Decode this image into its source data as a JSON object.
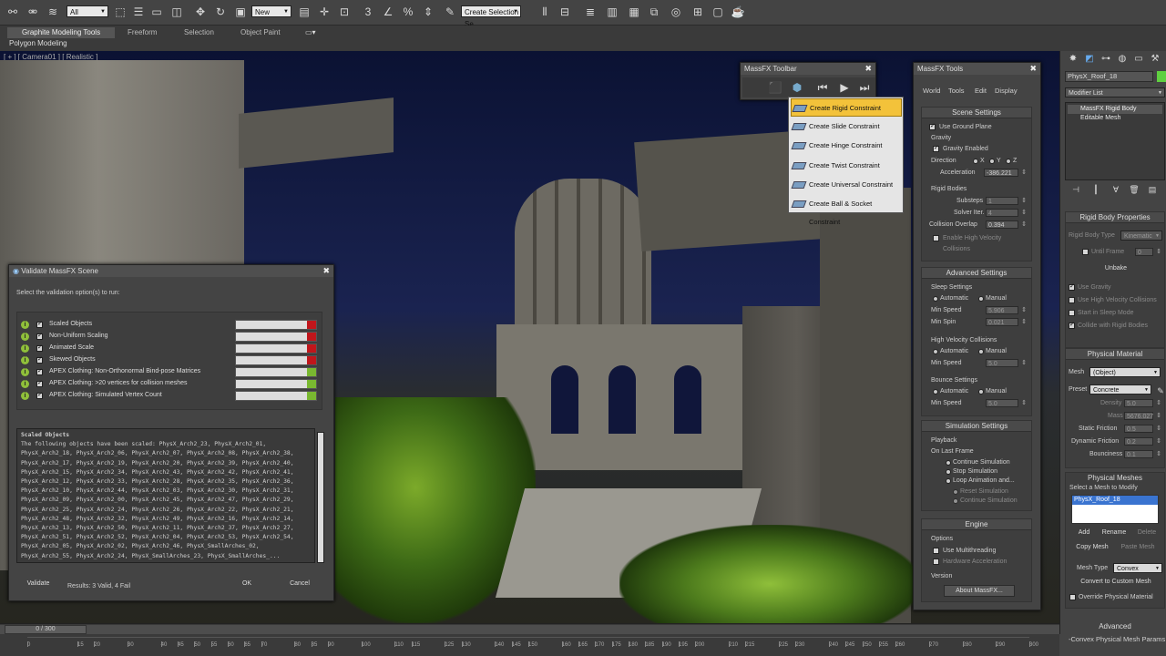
{
  "toolbar": {
    "filter": "All",
    "selection_set": "New",
    "named_selection": "Create Selection Se"
  },
  "ribbon": {
    "tabs": [
      "Graphite Modeling Tools",
      "Freeform",
      "Selection",
      "Object Paint"
    ],
    "sub_label": "Polygon Modeling"
  },
  "viewport": {
    "label": "[ + ] [ Camera01 ] [ Realistic ]"
  },
  "validate": {
    "title": "Validate MassFX Scene",
    "instruction": "Select the validation option(s) to run:",
    "rows": [
      {
        "label": "Scaled Objects",
        "status": "fail"
      },
      {
        "label": "Non-Uniform Scaling",
        "status": "fail"
      },
      {
        "label": "Animated Scale",
        "status": "fail"
      },
      {
        "label": "Skewed Objects",
        "status": "fail"
      },
      {
        "label": "APEX Clothing: Non-Orthonormal Bind-pose Matrices",
        "status": "pass"
      },
      {
        "label": "APEX Clothing: >20 vertices for collision meshes",
        "status": "pass"
      },
      {
        "label": "APEX Clothing: Simulated Vertex Count",
        "status": "pass"
      }
    ],
    "details_lines": [
      "Scaled Objects",
      "The following objects have been scaled: PhysX_Arch2_23, PhysX_Arch2_01,",
      "PhysX_Arch2_18, PhysX_Arch2_06, PhysX_Arch2_07, PhysX_Arch2_08, PhysX_Arch2_38,",
      "PhysX_Arch2_17, PhysX_Arch2_19, PhysX_Arch2_20, PhysX_Arch2_39, PhysX_Arch2_40,",
      "PhysX_Arch2_15, PhysX_Arch2_34, PhysX_Arch2_43, PhysX_Arch2_42, PhysX_Arch2_41,",
      "PhysX_Arch2_12, PhysX_Arch2_33, PhysX_Arch2_28, PhysX_Arch2_35, PhysX_Arch2_36,",
      "PhysX_Arch2_10, PhysX_Arch2_44, PhysX_Arch2_03, PhysX_Arch2_30, PhysX_Arch2_31,",
      "PhysX_Arch2_09, PhysX_Arch2_00, PhysX_Arch2_45, PhysX_Arch2_47, PhysX_Arch2_29,",
      "PhysX_Arch2_25, PhysX_Arch2_24, PhysX_Arch2_26, PhysX_Arch2_22, PhysX_Arch2_21,",
      "PhysX_Arch2_48, PhysX_Arch2_32, PhysX_Arch2_49, PhysX_Arch2_16, PhysX_Arch2_14,",
      "PhysX_Arch2_13, PhysX_Arch2_50, PhysX_Arch2_11, PhysX_Arch2_37, PhysX_Arch2_27,",
      "PhysX_Arch2_51, PhysX_Arch2_52, PhysX_Arch2_04, PhysX_Arch2_53, PhysX_Arch2_54,",
      "PhysX_Arch2_05, PhysX_Arch2_02, PhysX_Arch2_46, PhysX_SmallArches_02,",
      "PhysX_Arch2_55, PhysX_Arch2_24, PhysX_SmallArches_23, PhysX_SmallArches_..."
    ],
    "validate_button": "Validate",
    "results": "Results: 3 Valid, 4 Fail",
    "ok_button": "OK",
    "cancel_button": "Cancel"
  },
  "massfx_toolbar": {
    "title": "MassFX Toolbar",
    "menu": [
      "Create Rigid Constraint",
      "Create Slide Constraint",
      "Create Hinge Constraint",
      "Create Twist Constraint",
      "Create Universal Constraint",
      "Create Ball & Socket Constraint"
    ]
  },
  "massfx_tools": {
    "title": "MassFX Tools",
    "tabs": [
      "World",
      "Tools",
      "Edit",
      "Display"
    ],
    "scene_settings": {
      "head": "Scene Settings",
      "use_ground_plane": "Use Ground Plane",
      "gravity": "Gravity",
      "gravity_enabled": "Gravity Enabled",
      "direction": "Direction",
      "axes": [
        "X",
        "Y",
        "Z"
      ],
      "acceleration": "Acceleration",
      "acceleration_value": "-386.221",
      "rigid_bodies": "Rigid Bodies",
      "substeps": "Substeps",
      "substeps_value": "1",
      "solver_iter": "Solver Iter.",
      "solver_iter_value": "4",
      "collision_overlap": "Collision Overlap",
      "collision_overlap_value": "0.394",
      "enable_high_velocity": "Enable High Velocity",
      "collisions": "Collisions"
    },
    "advanced": {
      "head": "Advanced Settings",
      "sleep_settings": "Sleep Settings",
      "automatic": "Automatic",
      "manual": "Manual",
      "min_speed": "Min Speed",
      "min_speed_value": "5.906",
      "min_spin": "Min Spin",
      "min_spin_value": "0.021",
      "high_velocity": "High Velocity Collisions",
      "hv_min_speed_value": "5.0",
      "bounce_settings": "Bounce Settings",
      "bounce_min_speed_value": "5.0"
    },
    "simulation": {
      "head": "Simulation Settings",
      "playback": "Playback",
      "on_last_frame": "On Last Frame",
      "options": [
        "Continue Simulation",
        "Stop Simulation",
        "Loop Animation and..."
      ],
      "reset_simulation": "Reset Simulation",
      "continue_simulation": "Continue Simulation"
    },
    "engine": {
      "head": "Engine",
      "options": "Options",
      "use_multithreading": "Use Multithreading",
      "hardware_acceleration": "Hardware Acceleration",
      "version": "Version",
      "about": "About MassFX..."
    }
  },
  "command_panel": {
    "object_name": "PhysX_Roof_18",
    "modifier_list": "Modifier List",
    "stack": [
      "MassFX Rigid Body",
      "Editable Mesh"
    ],
    "rigid_body_properties": "Rigid Body Properties",
    "rigid_body_type_label": "Rigid Body Type",
    "rigid_body_type": "Kinematic",
    "until_frame": "Until Frame",
    "until_frame_value": "0",
    "unbake": "Unbake",
    "use_gravity": "Use Gravity",
    "use_high_velocity": "Use High Velocity Collisions",
    "start_in_sleep": "Start in Sleep Mode",
    "collide_with_rigid": "Collide with Rigid Bodies",
    "physical_material": "Physical Material",
    "mesh_label": "Mesh",
    "mesh_value": "(Object)",
    "preset_label": "Preset",
    "preset_value": "Concrete",
    "density": "Density",
    "density_value": "5.0",
    "mass": "Mass",
    "mass_value": "5676.027",
    "static_friction": "Static Friction",
    "static_friction_value": "0.5",
    "dynamic_friction": "Dynamic Friction",
    "dynamic_friction_value": "0.2",
    "bounciness": "Bounciness",
    "bounciness_value": "0.1",
    "physical_meshes": "Physical Meshes",
    "select_mesh": "Select a Mesh to Modify",
    "mesh_list": "PhysX_Roof_18",
    "add": "Add",
    "rename": "Rename",
    "delete": "Delete",
    "copy_mesh": "Copy Mesh",
    "paste_mesh": "Paste Mesh",
    "mesh_type_label": "Mesh Type",
    "mesh_type_value": "Convex",
    "convert_custom": "Convert to Custom Mesh",
    "override_material": "Override Physical Material",
    "advanced": "Advanced",
    "convex_params": "-Convex Physical Mesh Params"
  },
  "timeline": {
    "frame": "0 / 300",
    "ticks": [
      "0",
      "15",
      "20",
      "30",
      "40",
      "45",
      "50",
      "55",
      "60",
      "65",
      "70",
      "80",
      "85",
      "90",
      "100",
      "110",
      "115",
      "125",
      "130",
      "140",
      "145",
      "150",
      "160",
      "165",
      "170",
      "175",
      "180",
      "185",
      "190",
      "195",
      "200",
      "210",
      "215",
      "225",
      "230",
      "240",
      "245",
      "250",
      "255",
      "260",
      "270",
      "280",
      "290",
      "300"
    ]
  },
  "colors": {
    "fail": "#c0161b",
    "pass": "#79b830",
    "highlight": "#f3c23a",
    "selection": "#3a74d0"
  }
}
